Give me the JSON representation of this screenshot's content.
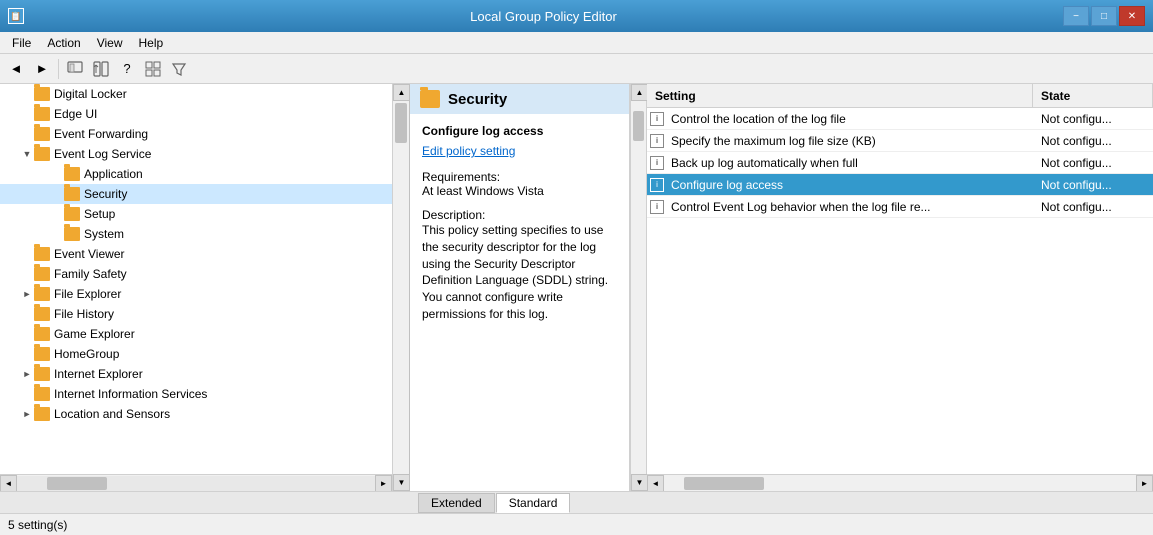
{
  "app": {
    "title": "Local Group Policy Editor",
    "minimize_label": "−",
    "maximize_label": "□",
    "close_label": "✕"
  },
  "menu": {
    "items": [
      "File",
      "Action",
      "View",
      "Help"
    ]
  },
  "toolbar": {
    "buttons": [
      "◄",
      "►",
      "⬆",
      "▦",
      "⬆",
      "?",
      "▦",
      "▾"
    ]
  },
  "tree": {
    "items": [
      {
        "label": "Digital Locker",
        "indent": 1,
        "expanded": false
      },
      {
        "label": "Edge UI",
        "indent": 1,
        "expanded": false
      },
      {
        "label": "Event Forwarding",
        "indent": 1,
        "expanded": false
      },
      {
        "label": "Event Log Service",
        "indent": 1,
        "expanded": true
      },
      {
        "label": "Application",
        "indent": 2,
        "expanded": false
      },
      {
        "label": "Security",
        "indent": 2,
        "expanded": false,
        "selected": true
      },
      {
        "label": "Setup",
        "indent": 2,
        "expanded": false
      },
      {
        "label": "System",
        "indent": 2,
        "expanded": false
      },
      {
        "label": "Event Viewer",
        "indent": 1,
        "expanded": false
      },
      {
        "label": "Family Safety",
        "indent": 1,
        "expanded": false
      },
      {
        "label": "File Explorer",
        "indent": 1,
        "expanded": false,
        "has_children": true
      },
      {
        "label": "File History",
        "indent": 1,
        "expanded": false
      },
      {
        "label": "Game Explorer",
        "indent": 1,
        "expanded": false
      },
      {
        "label": "HomeGroup",
        "indent": 1,
        "expanded": false
      },
      {
        "label": "Internet Explorer",
        "indent": 1,
        "expanded": false,
        "has_children": true
      },
      {
        "label": "Internet Information Services",
        "indent": 1,
        "expanded": false
      },
      {
        "label": "Location and Sensors",
        "indent": 1,
        "expanded": false,
        "has_children": true
      }
    ]
  },
  "middle": {
    "header": "Security",
    "setting_name": "Configure log access",
    "edit_label": "Edit policy setting",
    "requirements_label": "Requirements:",
    "requirements_value": "At least Windows Vista",
    "description_label": "Description:",
    "description_text": "This policy setting specifies to use the security descriptor for the log using the Security Descriptor Definition Language (SDDL) string. You cannot configure write permissions for this log."
  },
  "right": {
    "col_setting": "Setting",
    "col_state": "State",
    "rows": [
      {
        "label": "Control the location of the log file",
        "state": "Not configu...",
        "selected": false
      },
      {
        "label": "Specify the maximum log file size (KB)",
        "state": "Not configu...",
        "selected": false
      },
      {
        "label": "Back up log automatically when full",
        "state": "Not configu...",
        "selected": false
      },
      {
        "label": "Configure log access",
        "state": "Not configu...",
        "selected": true
      },
      {
        "label": "Control Event Log behavior when the log file re...",
        "state": "Not configu...",
        "selected": false
      }
    ]
  },
  "tabs": [
    {
      "label": "Extended",
      "active": false
    },
    {
      "label": "Standard",
      "active": true
    }
  ],
  "status": {
    "text": "5 setting(s)"
  }
}
